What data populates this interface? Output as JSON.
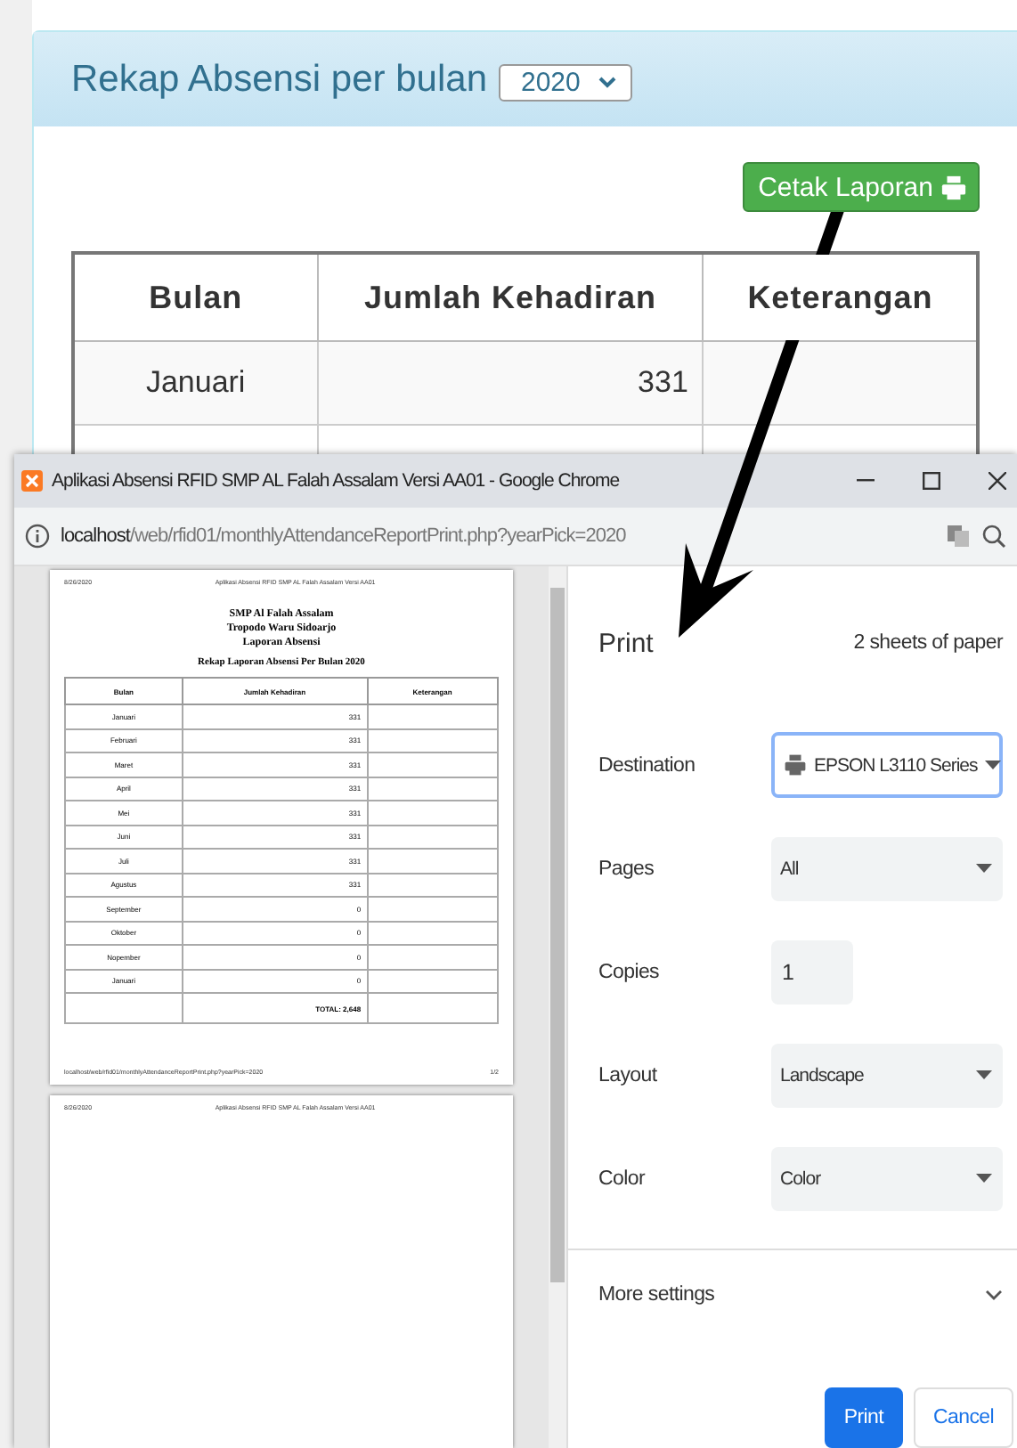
{
  "page": {
    "title": "Rekap Absensi per bulan",
    "year_select": {
      "value": "2020"
    },
    "print_button": {
      "label": "Cetak Laporan"
    },
    "table": {
      "columns": [
        "Bulan",
        "Jumlah Kehadiran",
        "Keterangan"
      ],
      "rows": [
        {
          "month": "Januari",
          "count": "331"
        }
      ]
    }
  },
  "chrome_window": {
    "title": "Aplikasi Absensi RFID SMP AL Falah Assalam Versi AA01 - Google Chrome",
    "url": {
      "host": "localhost",
      "path": "/web/rfid01/monthlyAttendanceReportPrint.php?yearPick=2020"
    },
    "preview": {
      "pages": [
        {
          "header_date": "8/26/2020",
          "header_title": "Aplikasi Absensi RFID SMP AL Falah Assalam Versi AA01",
          "heading": [
            "SMP Al Falah Assalam",
            "Tropodo Waru Sidoarjo",
            "Laporan Absensi"
          ],
          "report_title": "Rekap Laporan Absensi Per Bulan 2020",
          "columns": [
            "Bulan",
            "Jumlah Kehadiran",
            "Keterangan"
          ],
          "rows": [
            {
              "month": "Januari",
              "count": "331"
            },
            {
              "month": "Februari",
              "count": "331"
            },
            {
              "month": "Maret",
              "count": "331"
            },
            {
              "month": "April",
              "count": "331"
            },
            {
              "month": "Mei",
              "count": "331"
            },
            {
              "month": "Juni",
              "count": "331"
            },
            {
              "month": "Juli",
              "count": "331"
            },
            {
              "month": "Agustus",
              "count": "331"
            },
            {
              "month": "September",
              "count": "0"
            },
            {
              "month": "Oktober",
              "count": "0"
            },
            {
              "month": "Nopember",
              "count": "0"
            },
            {
              "month": "Januari",
              "count": "0"
            }
          ],
          "total": "TOTAL: 2,648",
          "footer_url": "localhost/web/rfid01/monthlyAttendanceReportPrint.php?yearPick=2020",
          "footer_page": "1/2"
        },
        {
          "header_date": "8/26/2020",
          "header_title": "Aplikasi Absensi RFID SMP AL Falah Assalam Versi AA01"
        }
      ]
    },
    "print_panel": {
      "title": "Print",
      "sheets": "2 sheets of paper",
      "settings": [
        {
          "label": "Destination",
          "kind": "select",
          "value": "EPSON L3110 Series",
          "focused": true
        },
        {
          "label": "Pages",
          "kind": "select",
          "value": "All",
          "focused": false
        },
        {
          "label": "Copies",
          "kind": "input",
          "value": "1",
          "focused": false
        },
        {
          "label": "Layout",
          "kind": "select",
          "value": "Landscape",
          "focused": false
        },
        {
          "label": "Color",
          "kind": "select",
          "value": "Color",
          "focused": false
        }
      ],
      "more_settings": "More settings",
      "buttons": [
        {
          "label": "Print",
          "kind": "primary"
        },
        {
          "label": "Cancel",
          "kind": "secondary"
        }
      ]
    }
  }
}
